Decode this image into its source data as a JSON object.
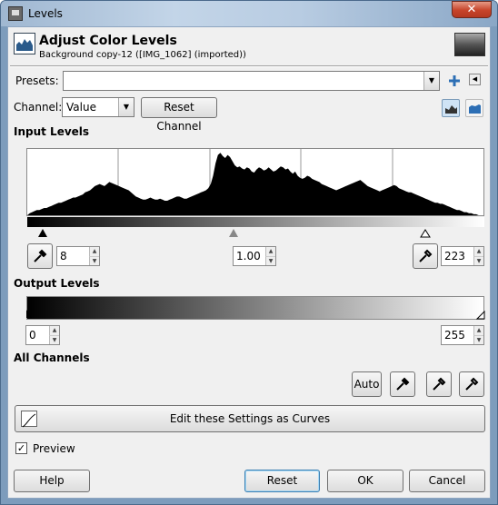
{
  "window": {
    "title": "Levels",
    "close_label": "✕"
  },
  "header": {
    "title": "Adjust Color Levels",
    "subtitle": "Background copy-12 ([IMG_1062] (imported))"
  },
  "presets": {
    "label": "Presets:",
    "value": ""
  },
  "channel": {
    "label": "Channel:",
    "value": "Value",
    "reset_label": "Reset Channel"
  },
  "input_levels": {
    "heading": "Input Levels",
    "low": "8",
    "gamma": "1.00",
    "high": "223"
  },
  "output_levels": {
    "heading": "Output Levels",
    "low": "0",
    "high": "255"
  },
  "all_channels": {
    "heading": "All Channels",
    "auto_label": "Auto"
  },
  "curves_button": {
    "label": "Edit these Settings as Curves"
  },
  "preview": {
    "label": "Preview",
    "checked": true
  },
  "footer": {
    "help": "Help",
    "reset": "Reset",
    "ok": "OK",
    "cancel": "Cancel"
  },
  "histogram_data": [
    0,
    2,
    3,
    4,
    5,
    5,
    6,
    7,
    7,
    8,
    9,
    10,
    11,
    12,
    12,
    13,
    14,
    15,
    16,
    17,
    17,
    18,
    19,
    20,
    22,
    23,
    24,
    26,
    28,
    29,
    30,
    29,
    28,
    30,
    32,
    31,
    30,
    29,
    28,
    27,
    26,
    25,
    24,
    22,
    20,
    18,
    17,
    16,
    15,
    15,
    16,
    17,
    16,
    15,
    15,
    16,
    15,
    14,
    14,
    15,
    16,
    17,
    18,
    18,
    17,
    16,
    16,
    17,
    18,
    19,
    20,
    21,
    22,
    23,
    24,
    26,
    30,
    38,
    50,
    58,
    60,
    57,
    55,
    58,
    56,
    52,
    48,
    46,
    47,
    45,
    44,
    46,
    45,
    42,
    41,
    44,
    46,
    45,
    43,
    44,
    46,
    44,
    42,
    43,
    45,
    47,
    46,
    44,
    45,
    42,
    40,
    42,
    38,
    36,
    35,
    36,
    38,
    37,
    35,
    34,
    33,
    32,
    30,
    29,
    28,
    27,
    26,
    25,
    24,
    25,
    26,
    27,
    28,
    29,
    30,
    31,
    32,
    33,
    34,
    32,
    30,
    28,
    27,
    26,
    25,
    24,
    23,
    24,
    25,
    26,
    27,
    28,
    29,
    28,
    26,
    25,
    24,
    23,
    22,
    22,
    21,
    20,
    19,
    18,
    17,
    16,
    15,
    14,
    13,
    12,
    12,
    11,
    11,
    10,
    9,
    8,
    7,
    6,
    5,
    5,
    4,
    3,
    3,
    2,
    2,
    1,
    1,
    0,
    0,
    0
  ]
}
